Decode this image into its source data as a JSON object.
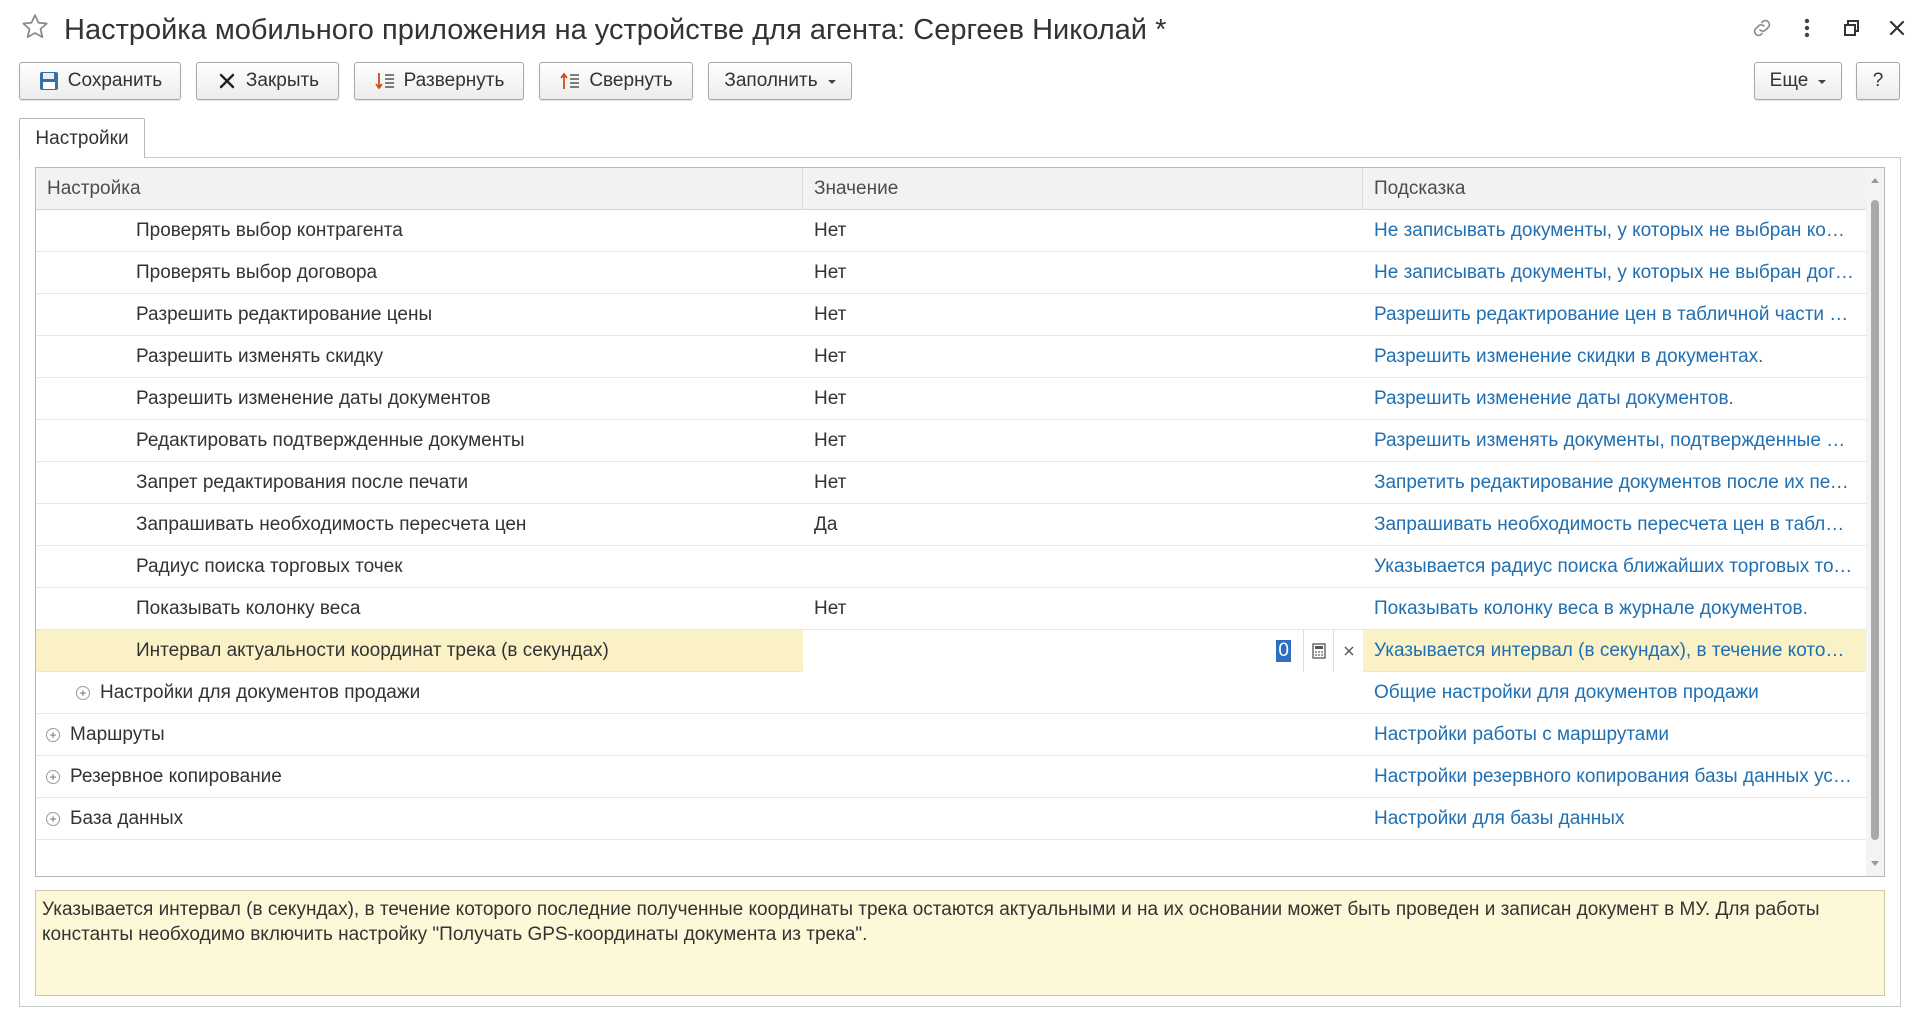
{
  "window": {
    "title": "Настройка мобильного приложения на устройстве для агента: Сергеев Николай *"
  },
  "toolbar": {
    "save": "Сохранить",
    "close": "Закрыть",
    "expand": "Развернуть",
    "collapse": "Свернуть",
    "fill": "Заполнить",
    "more": "Еще",
    "help": "?"
  },
  "tabs": [
    {
      "label": "Настройки",
      "active": true
    }
  ],
  "grid": {
    "columns": {
      "setting": "Настройка",
      "value": "Значение",
      "hint": "Подсказка"
    },
    "rows": [
      {
        "name": "Проверять выбор контрагента",
        "value": "Нет",
        "hint": "Не записывать документы, у которых не выбран контрагент.",
        "level": 2
      },
      {
        "name": "Проверять выбор договора",
        "value": "Нет",
        "hint": "Не записывать документы, у которых не выбран договор.",
        "level": 2
      },
      {
        "name": "Разрешить редактирование цены",
        "value": "Нет",
        "hint": "Разрешить редактирование цен в табличной части документов.",
        "level": 2
      },
      {
        "name": "Разрешить изменять скидку",
        "value": "Нет",
        "hint": "Разрешить изменение скидки в документах.",
        "level": 2
      },
      {
        "name": "Разрешить изменение даты документов",
        "value": "Нет",
        "hint": "Разрешить изменение даты документов.",
        "level": 2
      },
      {
        "name": "Редактировать подтвержденные документы",
        "value": "Нет",
        "hint": "Разрешить изменять документы, подтвержденные сервером.",
        "level": 2
      },
      {
        "name": "Запрет редактирования после печати",
        "value": "Нет",
        "hint": "Запретить редактирование документов после их печати.",
        "level": 2
      },
      {
        "name": "Запрашивать необходимость пересчета цен",
        "value": "Да",
        "hint": "Запрашивать необходимость пересчета цен в табличной части.",
        "level": 2
      },
      {
        "name": "Радиус поиска торговых точек",
        "value": "",
        "hint": "Указывается радиус поиска ближайших торговых точек.",
        "level": 2
      },
      {
        "name": "Показывать колонку веса",
        "value": "Нет",
        "hint": "Показывать колонку веса в журнале документов.",
        "level": 2
      },
      {
        "name": "Интервал актуальности координат трека (в секундах)",
        "value": "0",
        "hint": "Указывается интервал (в секундах), в течение которого последние полученные координаты трека остаются актуальными.",
        "level": 2,
        "selected": true,
        "editing": true
      },
      {
        "name": "Настройки для документов продажи",
        "value": "",
        "hint": "Общие настройки для документов продажи",
        "level": 1,
        "group": true
      },
      {
        "name": "Маршруты",
        "value": "",
        "hint": "Настройки работы с маршрутами",
        "level": 0,
        "group": true
      },
      {
        "name": "Резервное копирование",
        "value": "",
        "hint": "Настройки резервного копирования базы данных устройства",
        "level": 0,
        "group": true
      },
      {
        "name": "База данных",
        "value": "",
        "hint": "Настройки для базы данных",
        "level": 0,
        "group": true
      }
    ]
  },
  "description": "Указывается интервал (в секундах), в течение которого последние полученные координаты трека остаются актуальными и на их основании может быть проведен и записан документ в МУ. Для работы константы необходимо включить настройку \"Получать GPS-координаты документа из трека\".",
  "colors": {
    "hint_link": "#1f6fb2",
    "selected_row": "#fbf1c6",
    "description_bg": "#fdf9d8",
    "save_icon": "#3a6ea5"
  },
  "icons": {
    "favorite": "star-icon",
    "link": "link-icon",
    "menu": "more-vertical-icon",
    "restore": "restore-window-icon",
    "close": "close-icon"
  }
}
